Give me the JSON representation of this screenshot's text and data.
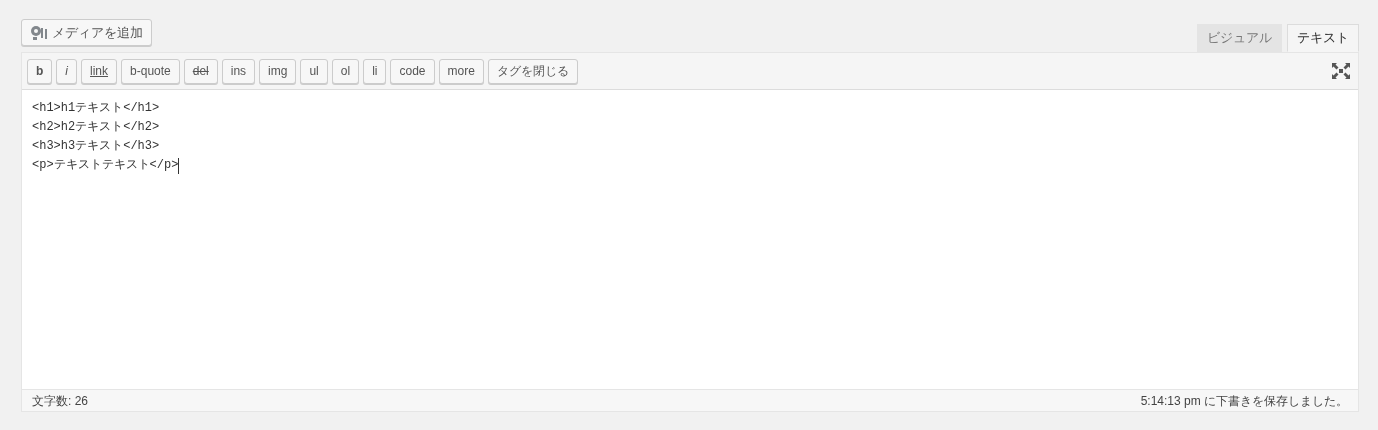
{
  "media_button": {
    "label": "メディアを追加"
  },
  "tabs": [
    {
      "label": "ビジュアル",
      "selected": false
    },
    {
      "label": "テキスト",
      "selected": true
    }
  ],
  "quicktags": [
    {
      "label": "b",
      "kind": "bold"
    },
    {
      "label": "i",
      "kind": "italic"
    },
    {
      "label": "link",
      "kind": "link"
    },
    {
      "label": "b-quote",
      "kind": "plain"
    },
    {
      "label": "del",
      "kind": "strike"
    },
    {
      "label": "ins",
      "kind": "plain"
    },
    {
      "label": "img",
      "kind": "plain"
    },
    {
      "label": "ul",
      "kind": "plain"
    },
    {
      "label": "ol",
      "kind": "plain"
    },
    {
      "label": "li",
      "kind": "plain"
    },
    {
      "label": "code",
      "kind": "plain"
    },
    {
      "label": "more",
      "kind": "plain"
    },
    {
      "label": "タグを閉じる",
      "kind": "plain"
    }
  ],
  "editor": {
    "lines": [
      "<h1>h1テキスト</h1>",
      "<h2>h2テキスト</h2>",
      "<h3>h3テキスト</h3>",
      "<p>テキストテキスト</p>"
    ]
  },
  "status_bar": {
    "word_count": "文字数: 26",
    "autosave": "5:14:13 pm に下書きを保存しました。"
  }
}
